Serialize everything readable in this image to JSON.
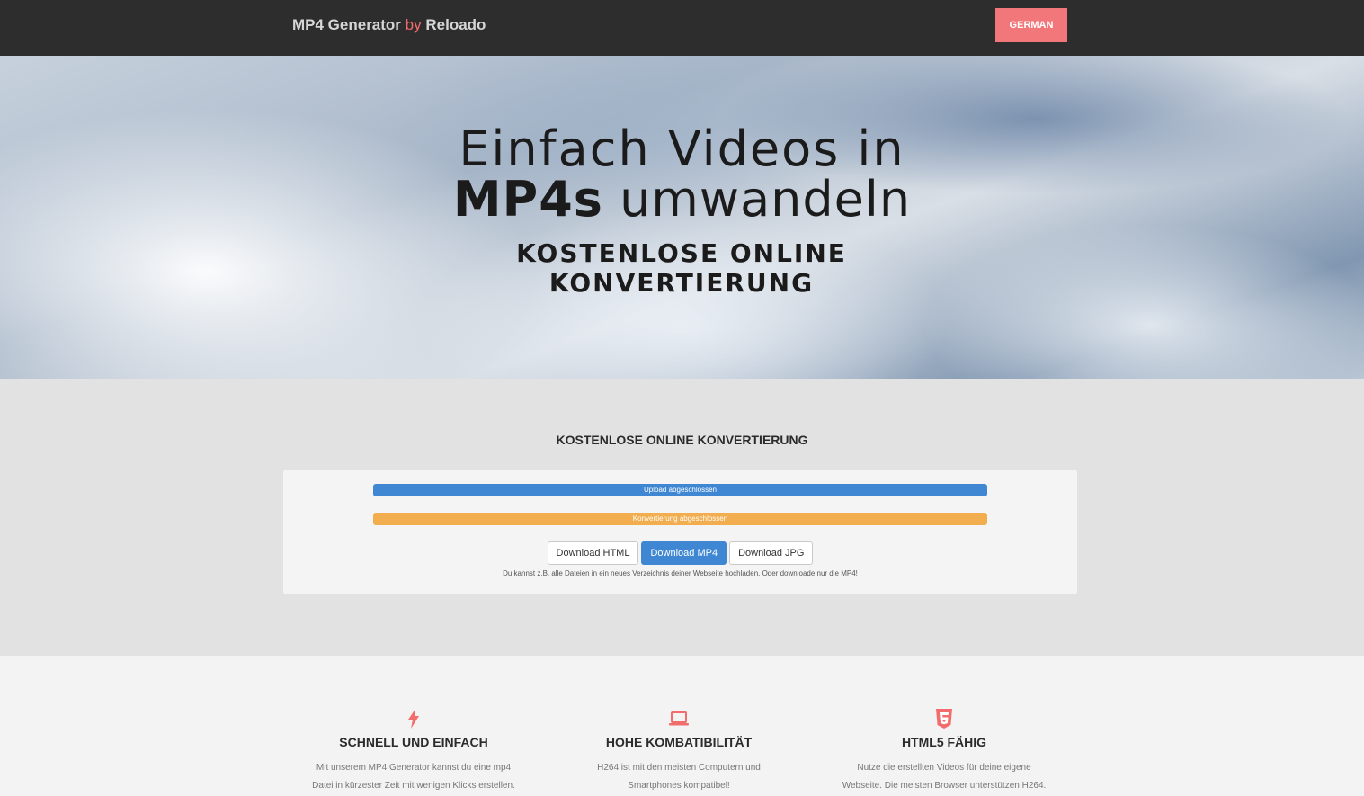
{
  "header": {
    "brand_main": "MP4 Generator",
    "brand_by": "by",
    "brand_company": "Reloado",
    "language_button": "GERMAN"
  },
  "hero": {
    "line1": "Einfach Videos in",
    "line2_bold": "MP4s",
    "line2_rest": "umwandeln",
    "subtitle": "KOSTENLOSE ONLINE KONVERTIERUNG"
  },
  "converter": {
    "title": "KOSTENLOSE ONLINE KONVERTIERUNG",
    "upload_bar_label": "Upload abgeschlossen",
    "convert_bar_label": "Konvertierung abgeschlossen",
    "buttons": {
      "download_html": "Download HTML",
      "download_mp4": "Download MP4",
      "download_jpg": "Download JPG"
    },
    "note": "Du kannst z.B. alle Dateien in ein neues Verzeichnis deiner Webseite hochladen. Oder downloade nur die MP4!",
    "colors": {
      "upload": "#3f87d3",
      "convert": "#f2ad4e"
    }
  },
  "features": [
    {
      "icon": "lightning-icon",
      "title": "SCHNELL UND EINFACH",
      "text_line1": "Mit unserem MP4 Generator kannst du eine mp4",
      "text_line2": "Datei in kürzester Zeit mit wenigen Klicks erstellen."
    },
    {
      "icon": "laptop-icon",
      "title": "HOHE KOMBATIBILITÄT",
      "text_line1": "H264 ist mit den meisten Computern und",
      "text_line2": "Smartphones kompatibel!"
    },
    {
      "icon": "html5-icon",
      "title": "HTML5 FÄHIG",
      "text_line1": "Nutze die erstellten Videos für deine eigene",
      "text_line2": "Webseite. Die meisten Browser unterstützen H264."
    }
  ],
  "accent_color": "#f26c6c"
}
